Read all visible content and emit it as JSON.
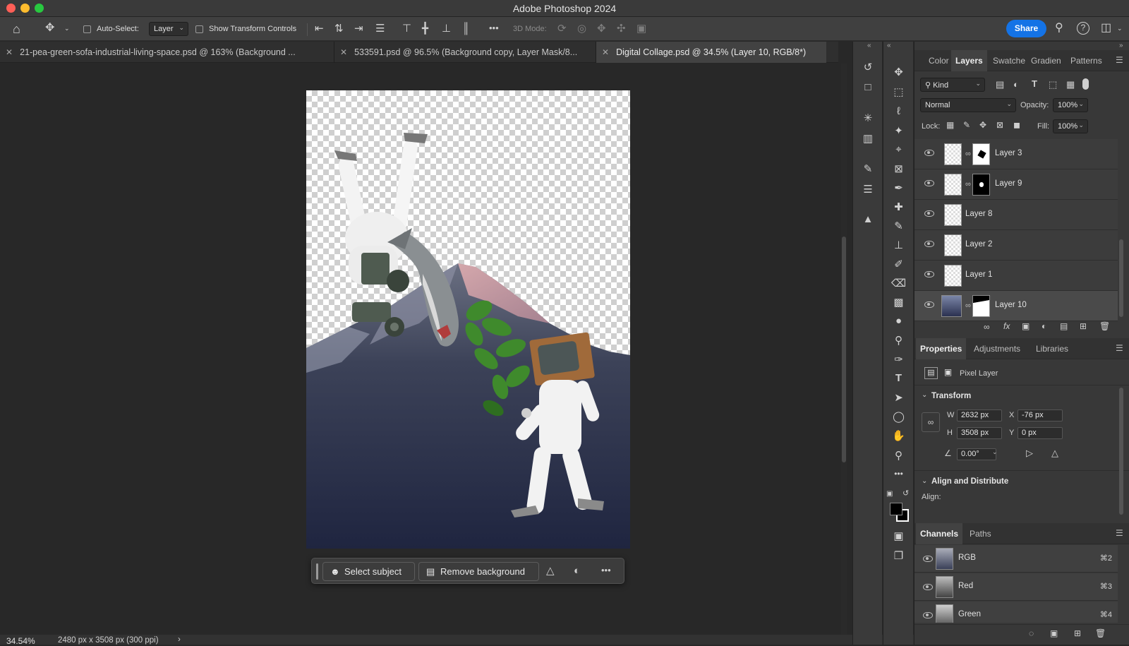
{
  "app": {
    "title": "Adobe Photoshop 2024",
    "share_label": "Share"
  },
  "options_bar": {
    "auto_select_label": "Auto-Select:",
    "auto_select_value": "Layer",
    "show_transform_label": "Show Transform Controls",
    "mode_3d_label": "3D Mode:",
    "more_label": "•••"
  },
  "tabs": [
    {
      "label": "21-pea-green-sofa-industrial-living-space.psd @ 163% (Background ..."
    },
    {
      "label": "533591.psd @ 96.5% (Background copy, Layer Mask/8..."
    },
    {
      "label": "Digital Collage.psd @ 34.5% (Layer 10, RGB/8*)"
    }
  ],
  "context_bar": {
    "select_subject": "Select subject",
    "remove_background": "Remove background"
  },
  "status": {
    "zoom": "34.54%",
    "doc_info": "2480 px x 3508 px (300 ppi)"
  },
  "layers_panel": {
    "tabs": [
      "Color",
      "Layers",
      "Swatche",
      "Gradien",
      "Patterns"
    ],
    "kind_label": "Kind",
    "blend_mode": "Normal",
    "opacity_label": "Opacity:",
    "opacity_value": "100%",
    "lock_label": "Lock:",
    "fill_label": "Fill:",
    "fill_value": "100%",
    "layers": [
      {
        "name": "Layer 3",
        "mask": "white-shape"
      },
      {
        "name": "Layer 9",
        "mask": "black"
      },
      {
        "name": "Layer 8"
      },
      {
        "name": "Layer 2"
      },
      {
        "name": "Layer 1"
      },
      {
        "name": "Layer 10",
        "mask": "mountain",
        "selected": true
      }
    ]
  },
  "properties_panel": {
    "tabs": [
      "Properties",
      "Adjustments",
      "Libraries"
    ],
    "pixel_layer_label": "Pixel Layer",
    "transform_title": "Transform",
    "w_label": "W",
    "w_value": "2632 px",
    "h_label": "H",
    "h_value": "3508 px",
    "x_label": "X",
    "x_value": "-76 px",
    "y_label": "Y",
    "y_value": "0 px",
    "angle_value": "0.00°",
    "align_title": "Align and Distribute",
    "align_label": "Align:"
  },
  "channels_panel": {
    "tabs": [
      "Channels",
      "Paths"
    ],
    "channels": [
      {
        "name": "RGB",
        "shortcut": "⌘2"
      },
      {
        "name": "Red",
        "shortcut": "⌘3"
      },
      {
        "name": "Green",
        "shortcut": "⌘4"
      }
    ]
  },
  "colors": {
    "accent": "#1473e6",
    "foreground": "#000000",
    "background": "#ffffff"
  }
}
